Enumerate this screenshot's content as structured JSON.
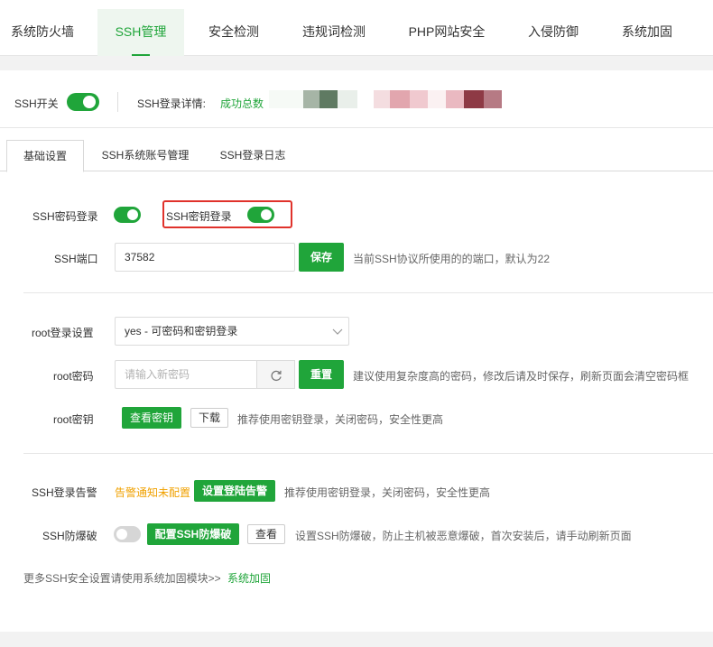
{
  "top_tabs": [
    {
      "label": "系统防火墙"
    },
    {
      "label": "SSH管理"
    },
    {
      "label": "安全检测"
    },
    {
      "label": "违规词检测"
    },
    {
      "label": "PHP网站安全"
    },
    {
      "label": "入侵防御"
    },
    {
      "label": "系统加固"
    }
  ],
  "active_top_tab": "SSH管理",
  "status": {
    "ssh_switch_label": "SSH开关",
    "ssh_switch_on": true,
    "login_detail_label": "SSH登录详情:",
    "login_success_label": "成功总数"
  },
  "sub_tabs": [
    {
      "label": "基础设置"
    },
    {
      "label": "SSH系统账号管理"
    },
    {
      "label": "SSH登录日志"
    }
  ],
  "active_sub_tab": "基础设置",
  "basic": {
    "password_login_label": "SSH密码登录",
    "password_login_on": true,
    "key_login_label": "SSH密钥登录",
    "key_login_on": true,
    "port_label": "SSH端口",
    "port_value": "37582",
    "save_label": "保存",
    "port_hint": "当前SSH协议所使用的的端口，默认为22"
  },
  "root": {
    "login_setting_label": "root登录设置",
    "login_setting_value": "yes - 可密码和密钥登录",
    "password_label": "root密码",
    "password_placeholder": "请输入新密码",
    "reset_label": "重置",
    "password_hint": "建议使用复杂度高的密码，修改后请及时保存，刷新页面会清空密码框",
    "key_label": "root密钥",
    "view_key_label": "查看密钥",
    "download_label": "下载",
    "key_hint": "推荐使用密钥登录，关闭密码，安全性更高"
  },
  "alerts": {
    "alert_label": "SSH登录告警",
    "alert_status": "告警通知未配置",
    "alert_button": "设置登陆告警",
    "alert_hint": "推荐使用密钥登录，关闭密码，安全性更高",
    "brute_label": "SSH防爆破",
    "brute_on": false,
    "brute_button": "配置SSH防爆破",
    "brute_view": "查看",
    "brute_hint": "设置SSH防爆破，防止主机被恶意爆破，首次安装后，请手动刷新页面"
  },
  "footer": {
    "text": "更多SSH安全设置请使用系统加固模块>>",
    "link": "系统加固"
  },
  "colors": {
    "accent": "#20a53a",
    "warning": "#f0a100",
    "highlight": "#e0322b"
  }
}
